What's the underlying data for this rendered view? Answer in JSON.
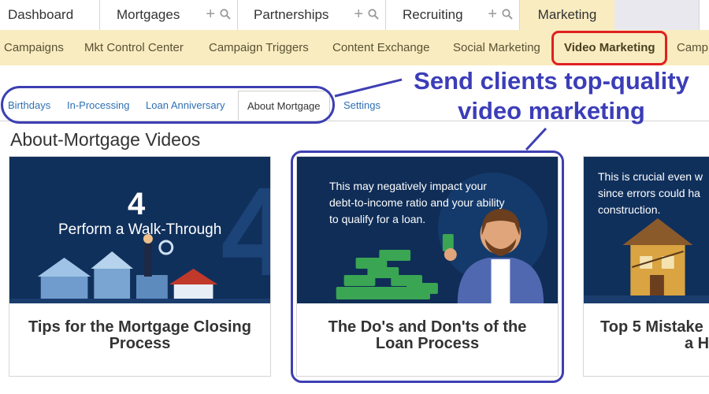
{
  "top_tabs": [
    {
      "label": "Dashboard"
    },
    {
      "label": "Mortgages"
    },
    {
      "label": "Partnerships"
    },
    {
      "label": "Recruiting"
    },
    {
      "label": "Marketing"
    }
  ],
  "sub_nav": {
    "items": [
      "Campaigns",
      "Mkt Control Center",
      "Campaign Triggers",
      "Content Exchange",
      "Social Marketing",
      "Video Marketing",
      "Camp"
    ],
    "active": "Video Marketing"
  },
  "third_nav": {
    "items": [
      "Birthdays",
      "In-Processing",
      "Loan Anniversary",
      "About Mortgage",
      "Settings"
    ],
    "active": "About Mortgage"
  },
  "callout": {
    "line1": "Send clients top-quality",
    "line2": "video marketing"
  },
  "section_title": "About-Mortgage Videos",
  "cards": [
    {
      "thumb_number": "4",
      "thumb_heading": "Perform a Walk-Through",
      "caption_line1": "Tips for the Mortgage Closing",
      "caption_line2": "Process"
    },
    {
      "thumb_line1": "This may negatively impact your",
      "thumb_line2": "debt-to-income ratio and your ability",
      "thumb_line3": "to qualify for a loan.",
      "caption_line1": "The Do's and Don'ts of the",
      "caption_line2": "Loan Process"
    },
    {
      "thumb_line1": "This is crucial even w",
      "thumb_line2": "since errors could ha",
      "thumb_line3": "construction.",
      "caption_line1": "Top 5 Mistake",
      "caption_line2": "a H"
    }
  ],
  "colors": {
    "nav_bg": "#f8ecc0",
    "annotation_blue": "#3d3fb3",
    "highlight_red": "#e02020",
    "link_blue": "#2f6fb3",
    "thumb_navy": "#10305c"
  },
  "icons": [
    "plus-icon",
    "search-icon"
  ]
}
